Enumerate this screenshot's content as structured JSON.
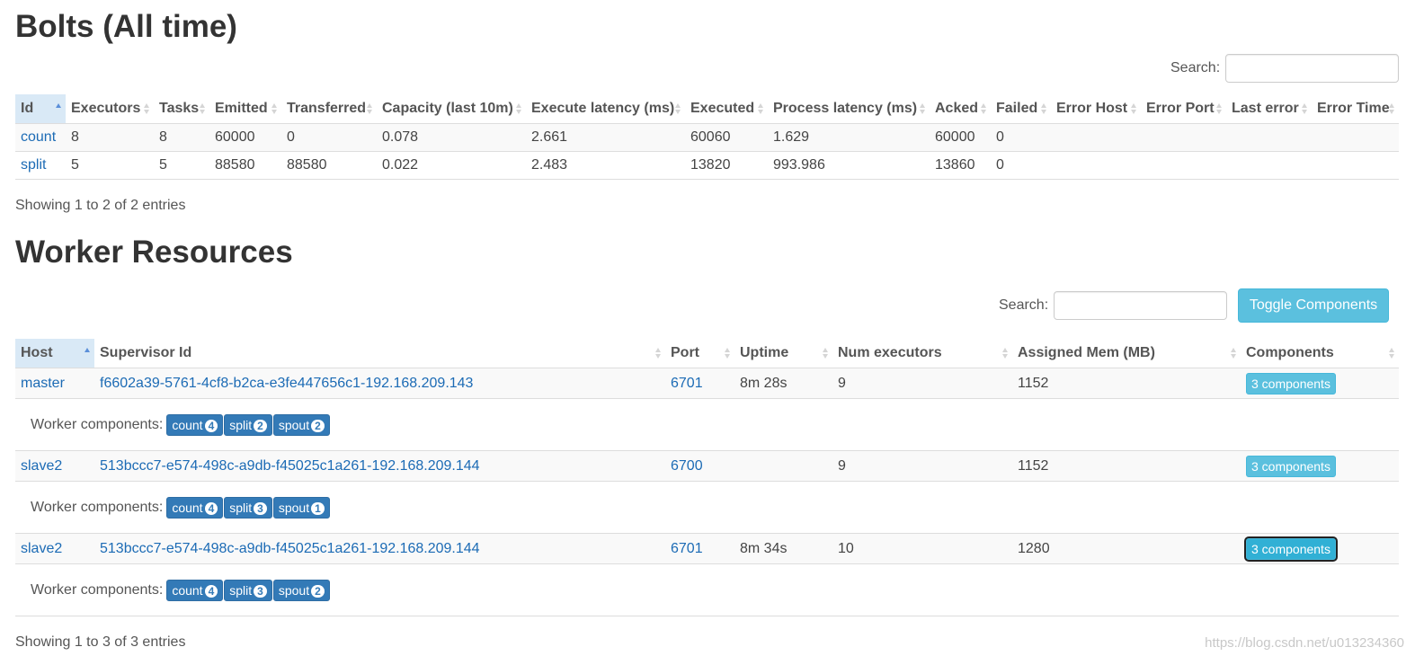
{
  "bolts": {
    "title": "Bolts (All time)",
    "search_label": "Search:",
    "search_value": "",
    "columns": [
      "Id",
      "Executors",
      "Tasks",
      "Emitted",
      "Transferred",
      "Capacity (last 10m)",
      "Execute latency (ms)",
      "Executed",
      "Process latency (ms)",
      "Acked",
      "Failed",
      "Error Host",
      "Error Port",
      "Last error",
      "Error Time"
    ],
    "rows": [
      [
        "count",
        "8",
        "8",
        "60000",
        "0",
        "0.078",
        "2.661",
        "60060",
        "1.629",
        "60000",
        "0",
        "",
        "",
        "",
        ""
      ],
      [
        "split",
        "5",
        "5",
        "88580",
        "88580",
        "0.022",
        "2.483",
        "13820",
        "993.986",
        "13860",
        "0",
        "",
        "",
        "",
        ""
      ]
    ],
    "info": "Showing 1 to 2 of 2 entries"
  },
  "workers": {
    "title": "Worker Resources",
    "search_label": "Search:",
    "search_value": "",
    "toggle_label": "Toggle Components",
    "columns": [
      "Host",
      "Supervisor Id",
      "Port",
      "Uptime",
      "Num executors",
      "Assigned Mem (MB)",
      "Components"
    ],
    "components_label": "Worker components:",
    "rows": [
      {
        "host": "master",
        "supervisor_id": "f6602a39-5761-4cf8-b2ca-e3fe447656c1-192.168.209.143",
        "port": "6701",
        "uptime": "8m 28s",
        "num_executors": "9",
        "assigned_mem": "1152",
        "components_button": "3 components",
        "components": [
          {
            "name": "count",
            "count": "4"
          },
          {
            "name": "split",
            "count": "2"
          },
          {
            "name": "spout",
            "count": "2"
          }
        ]
      },
      {
        "host": "slave2",
        "supervisor_id": "513bccc7-e574-498c-a9db-f45025c1a261-192.168.209.144",
        "port": "6700",
        "uptime": "",
        "num_executors": "9",
        "assigned_mem": "1152",
        "components_button": "3 components",
        "components": [
          {
            "name": "count",
            "count": "4"
          },
          {
            "name": "split",
            "count": "3"
          },
          {
            "name": "spout",
            "count": "1"
          }
        ]
      },
      {
        "host": "slave2",
        "supervisor_id": "513bccc7-e574-498c-a9db-f45025c1a261-192.168.209.144",
        "port": "6701",
        "uptime": "8m 34s",
        "num_executors": "10",
        "assigned_mem": "1280",
        "components_button": "3 components",
        "components": [
          {
            "name": "count",
            "count": "4"
          },
          {
            "name": "split",
            "count": "3"
          },
          {
            "name": "spout",
            "count": "2"
          }
        ]
      }
    ],
    "info": "Showing 1 to 3 of 3 entries"
  },
  "watermark": "https://blog.csdn.net/u013234360",
  "colors": {
    "link": "#1c6bb5",
    "info_button": "#5bc0de",
    "badge": "#337ab7",
    "sorted_header": "#d9e9f6"
  }
}
